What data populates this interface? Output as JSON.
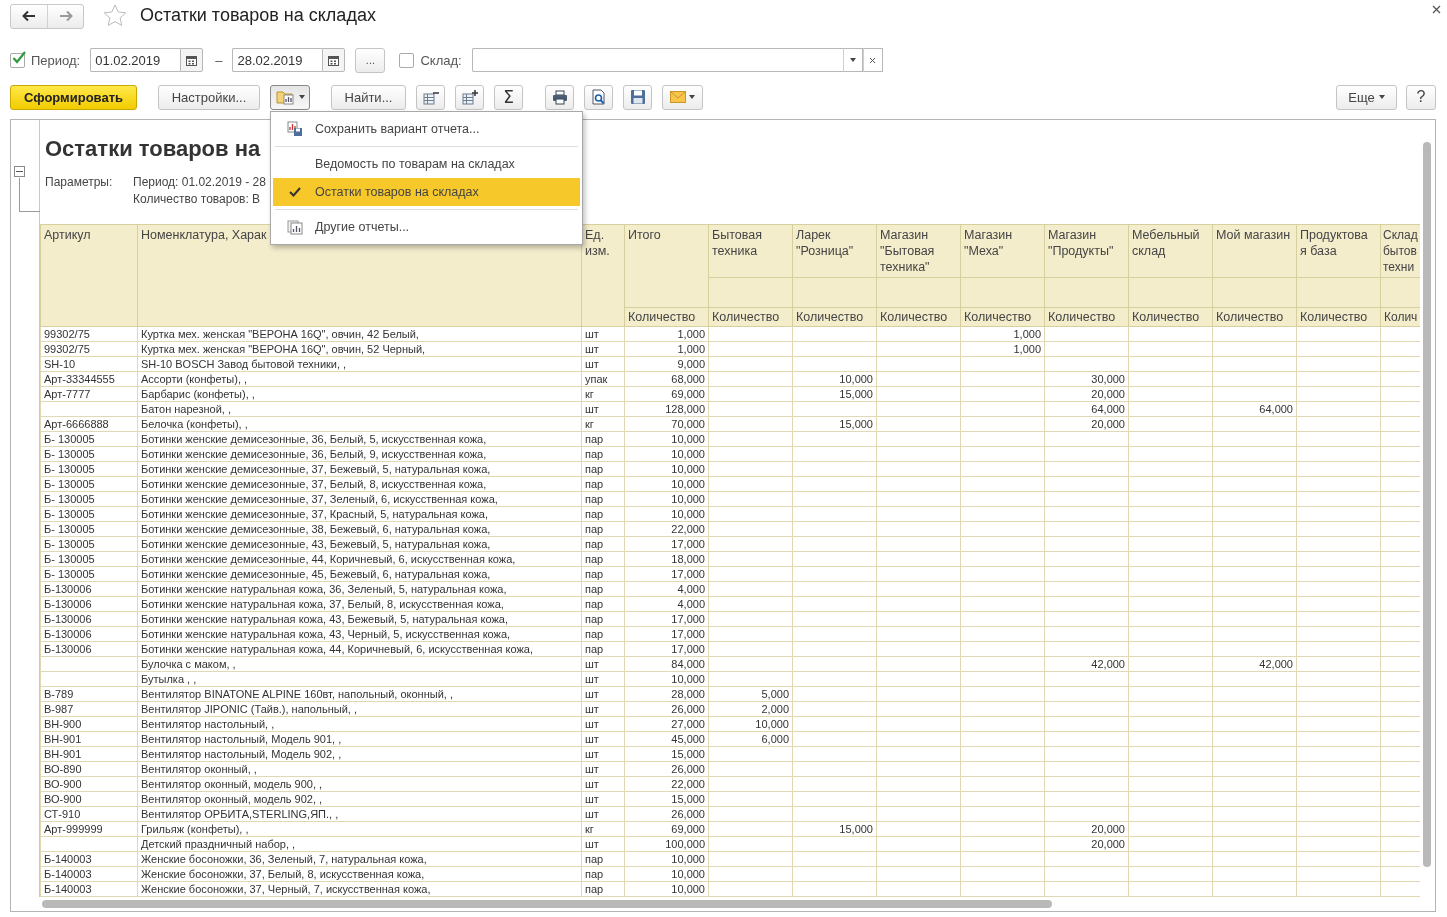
{
  "window": {
    "title": "Остатки товаров на складах",
    "favorite": false
  },
  "filters": {
    "period_enabled": true,
    "period_label": "Период:",
    "date_from": "01.02.2019",
    "dash": "–",
    "date_to": "28.02.2019",
    "more_button": "...",
    "warehouse_enabled": false,
    "warehouse_label": "Склад:"
  },
  "toolbar": {
    "generate": "Сформировать",
    "settings": "Настройки...",
    "find": "Найти...",
    "sum": "Σ",
    "more": "Еще",
    "help": "?"
  },
  "variants_menu": {
    "groups": [
      [
        {
          "kind": "save",
          "label": "Сохранить вариант отчета...",
          "selected": false
        }
      ],
      [
        {
          "kind": "variant",
          "label": "Ведомость по товарам на складах",
          "selected": false
        },
        {
          "kind": "variant",
          "label": "Остатки товаров на складах",
          "selected": true
        }
      ],
      [
        {
          "kind": "reports",
          "label": "Другие отчеты...",
          "selected": false
        }
      ]
    ]
  },
  "report": {
    "title": "Остатки товаров на",
    "expanded": true,
    "params_label": "Параметры:",
    "params": [
      "Период: 01.02.2019 - 28",
      "Количество товаров: В"
    ]
  },
  "table": {
    "columns": [
      {
        "label": "Артикул"
      },
      {
        "label": "Номенклатура, Харак"
      },
      {
        "label": "Ед. изм."
      },
      {
        "label": "Итого",
        "sub": "Количество"
      },
      {
        "label": "Бытовая техника",
        "sub": "Количество"
      },
      {
        "label": "Ларек \"Розница\"",
        "sub": "Количество"
      },
      {
        "label": "Магазин \"Бытовая техника\"",
        "sub": "Количество"
      },
      {
        "label": "Магазин \"Меха\"",
        "sub": "Количество"
      },
      {
        "label": "Магазин \"Продукты\"",
        "sub": "Количество"
      },
      {
        "label": "Мебельный склад",
        "sub": "Количество"
      },
      {
        "label": "Мой магазин",
        "sub": "Количество"
      },
      {
        "label": "Продуктова я база",
        "sub": "Количество"
      },
      {
        "label": "Склад\nбытов\nтехни",
        "sub": "Колич"
      }
    ],
    "rows": [
      {
        "article": "99302/75",
        "name": "Куртка мех. женская \"ВЕРОНА 16Q\", овчин, 42 Белый,",
        "unit": "шт",
        "total": "1,000",
        "shop_furs": "1,000"
      },
      {
        "article": "99302/75",
        "name": "Куртка мех. женская \"ВЕРОНА 16Q\", овчин, 52 Черный,",
        "unit": "шт",
        "total": "1,000",
        "shop_furs": "1,000"
      },
      {
        "article": "SH-10",
        "name": "SH-10 BOSCH Завод бытовой техники, ,",
        "unit": "шт",
        "total": "9,000"
      },
      {
        "article": "Арт-33344555",
        "name": "Ассорти (конфеты), ,",
        "unit": "упак",
        "total": "68,000",
        "kiosk": "10,000",
        "shop_food": "30,000"
      },
      {
        "article": "Арт-7777",
        "name": "Барбарис (конфеты), ,",
        "unit": "кг",
        "total": "69,000",
        "kiosk": "15,000",
        "shop_food": "20,000"
      },
      {
        "name": "Батон нарезной, ,",
        "unit": "шт",
        "total": "128,000",
        "shop_food": "64,000",
        "my_shop": "64,000"
      },
      {
        "article": "Арт-6666888",
        "name": "Белочка (конфеты), ,",
        "unit": "кг",
        "total": "70,000",
        "kiosk": "15,000",
        "shop_food": "20,000"
      },
      {
        "article": "Б- 130005",
        "name": "Ботинки женские демисезонные, 36, Белый, 5, искусственная кожа,",
        "unit": "пар",
        "total": "10,000"
      },
      {
        "article": "Б- 130005",
        "name": "Ботинки женские демисезонные, 36, Белый, 9, искусственная кожа,",
        "unit": "пар",
        "total": "10,000"
      },
      {
        "article": "Б- 130005",
        "name": "Ботинки женские демисезонные, 37, Бежевый, 5, натуральная кожа,",
        "unit": "пар",
        "total": "10,000"
      },
      {
        "article": "Б- 130005",
        "name": "Ботинки женские демисезонные, 37, Белый, 8, искусственная кожа,",
        "unit": "пар",
        "total": "10,000"
      },
      {
        "article": "Б- 130005",
        "name": "Ботинки женские демисезонные, 37, Зеленый, 6, искусственная кожа,",
        "unit": "пар",
        "total": "10,000"
      },
      {
        "article": "Б- 130005",
        "name": "Ботинки женские демисезонные, 37, Красный, 5, натуральная кожа,",
        "unit": "пар",
        "total": "10,000"
      },
      {
        "article": "Б- 130005",
        "name": "Ботинки женские демисезонные, 38, Бежевый, 6, натуральная кожа,",
        "unit": "пар",
        "total": "22,000"
      },
      {
        "article": "Б- 130005",
        "name": "Ботинки женские демисезонные, 43, Бежевый, 5, натуральная кожа,",
        "unit": "пар",
        "total": "17,000"
      },
      {
        "article": "Б- 130005",
        "name": "Ботинки женские демисезонные, 44, Коричневый, 6, искусственная кожа,",
        "unit": "пар",
        "total": "18,000"
      },
      {
        "article": "Б- 130005",
        "name": "Ботинки женские демисезонные, 45, Бежевый, 6, натуральная кожа,",
        "unit": "пар",
        "total": "17,000"
      },
      {
        "article": "Б-130006",
        "name": "Ботинки женские натуральная кожа, 36, Зеленый, 5, натуральная кожа,",
        "unit": "пар",
        "total": "4,000"
      },
      {
        "article": "Б-130006",
        "name": "Ботинки женские натуральная кожа, 37, Белый, 8, искусственная кожа,",
        "unit": "пар",
        "total": "4,000"
      },
      {
        "article": "Б-130006",
        "name": "Ботинки женские натуральная кожа, 43, Бежевый, 5, натуральная кожа,",
        "unit": "пар",
        "total": "17,000"
      },
      {
        "article": "Б-130006",
        "name": "Ботинки женские натуральная кожа, 43, Черный, 5, искусственная кожа,",
        "unit": "пар",
        "total": "17,000"
      },
      {
        "article": "Б-130006",
        "name": "Ботинки женские натуральная кожа, 44, Коричневый, 6, искусственная кожа,",
        "unit": "пар",
        "total": "17,000"
      },
      {
        "name": "Булочка с маком, ,",
        "unit": "шт",
        "total": "84,000",
        "shop_food": "42,000",
        "my_shop": "42,000"
      },
      {
        "name": "Бутылка , ,",
        "unit": "шт",
        "total": "10,000"
      },
      {
        "article": "В-789",
        "name": "Вентилятор BINATONE ALPINE 160вт, напольный, оконный, ,",
        "unit": "шт",
        "total": "28,000",
        "appliances": "5,000"
      },
      {
        "article": "В-987",
        "name": "Вентилятор JIPONIC (Тайв.), напольный, ,",
        "unit": "шт",
        "total": "26,000",
        "appliances": "2,000"
      },
      {
        "article": "ВН-900",
        "name": "Вентилятор настольный, ,",
        "unit": "шт",
        "total": "27,000",
        "appliances": "10,000"
      },
      {
        "article": "ВН-901",
        "name": "Вентилятор настольный, Модель 901, ,",
        "unit": "шт",
        "total": "45,000",
        "appliances": "6,000"
      },
      {
        "article": "ВН-901",
        "name": "Вентилятор настольный, Модель 902, ,",
        "unit": "шт",
        "total": "15,000"
      },
      {
        "article": "ВО-890",
        "name": "Вентилятор оконный, ,",
        "unit": "шт",
        "total": "26,000"
      },
      {
        "article": "ВО-900",
        "name": "Вентилятор оконный, модель 900, ,",
        "unit": "шт",
        "total": "22,000"
      },
      {
        "article": "ВО-900",
        "name": "Вентилятор оконный, модель 902, ,",
        "unit": "шт",
        "total": "15,000"
      },
      {
        "article": "СТ-910",
        "name": "Вентилятор ОРБИТА,STERLING,ЯП., ,",
        "unit": "шт",
        "total": "26,000"
      },
      {
        "article": "Арт-999999",
        "name": "Грильяж (конфеты), ,",
        "unit": "кг",
        "total": "69,000",
        "kiosk": "15,000",
        "shop_food": "20,000"
      },
      {
        "name": "Детский праздничный набор, ,",
        "unit": "шт",
        "total": "100,000",
        "shop_food": "20,000"
      },
      {
        "article": "Б-140003",
        "name": "Женские босоножки, 36, Зеленый, 7, натуральная кожа,",
        "unit": "пар",
        "total": "10,000"
      },
      {
        "article": "Б-140003",
        "name": "Женские босоножки, 37, Белый, 8, искусственная кожа,",
        "unit": "пар",
        "total": "10,000"
      },
      {
        "article": "Б-140003",
        "name": "Женские босоножки, 37, Черный, 7, искусственная кожа,",
        "unit": "пар",
        "total": "10,000"
      }
    ]
  }
}
